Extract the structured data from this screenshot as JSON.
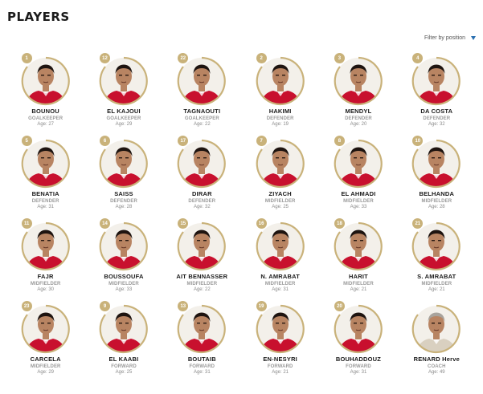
{
  "page": {
    "title": "PLAYERS"
  },
  "filter": {
    "label": "Filter by position",
    "icon": "funnel-icon"
  },
  "colors": {
    "frame": "#c9b27a",
    "jersey": "#c8102e",
    "skin": "#b88462",
    "hair": "#1e1410"
  },
  "age_label": "Age:",
  "players": [
    {
      "number": "1",
      "name": "BOUNOU",
      "position": "GOALKEEPER",
      "age": "27"
    },
    {
      "number": "12",
      "name": "EL KAJOUI",
      "position": "GOALKEEPER",
      "age": "29"
    },
    {
      "number": "22",
      "name": "TAGNAOUTI",
      "position": "GOALKEEPER",
      "age": "22"
    },
    {
      "number": "2",
      "name": "HAKIMI",
      "position": "DEFENDER",
      "age": "19"
    },
    {
      "number": "3",
      "name": "MENDYL",
      "position": "DEFENDER",
      "age": "20"
    },
    {
      "number": "4",
      "name": "DA COSTA",
      "position": "DEFENDER",
      "age": "32"
    },
    {
      "number": "5",
      "name": "BENATIA",
      "position": "DEFENDER",
      "age": "31"
    },
    {
      "number": "6",
      "name": "SAISS",
      "position": "DEFENDER",
      "age": "28"
    },
    {
      "number": "17",
      "name": "DIRAR",
      "position": "DEFENDER",
      "age": "32"
    },
    {
      "number": "7",
      "name": "ZIYACH",
      "position": "MIDFIELDER",
      "age": "25"
    },
    {
      "number": "8",
      "name": "EL AHMADI",
      "position": "MIDFIELDER",
      "age": "33"
    },
    {
      "number": "10",
      "name": "BELHANDA",
      "position": "MIDFIELDER",
      "age": "28"
    },
    {
      "number": "11",
      "name": "FAJR",
      "position": "MIDFIELDER",
      "age": "30"
    },
    {
      "number": "14",
      "name": "BOUSSOUFA",
      "position": "MIDFIELDER",
      "age": "33"
    },
    {
      "number": "15",
      "name": "AIT BENNASSER",
      "position": "MIDFIELDER",
      "age": "22"
    },
    {
      "number": "16",
      "name": "N. AMRABAT",
      "position": "MIDFIELDER",
      "age": "31"
    },
    {
      "number": "18",
      "name": "HARIT",
      "position": "MIDFIELDER",
      "age": "21"
    },
    {
      "number": "21",
      "name": "S. AMRABAT",
      "position": "MIDFIELDER",
      "age": "21"
    },
    {
      "number": "23",
      "name": "CARCELA",
      "position": "MIDFIELDER",
      "age": "29"
    },
    {
      "number": "9",
      "name": "EL KAABI",
      "position": "FORWARD",
      "age": "25"
    },
    {
      "number": "13",
      "name": "BOUTAIB",
      "position": "FORWARD",
      "age": "31"
    },
    {
      "number": "19",
      "name": "EN-NESYRI",
      "position": "FORWARD",
      "age": "21"
    },
    {
      "number": "20",
      "name": "BOUHADDOUZ",
      "position": "FORWARD",
      "age": "31"
    },
    {
      "number": "",
      "name": "RENARD Herve",
      "position": "COACH",
      "age": "49"
    }
  ]
}
